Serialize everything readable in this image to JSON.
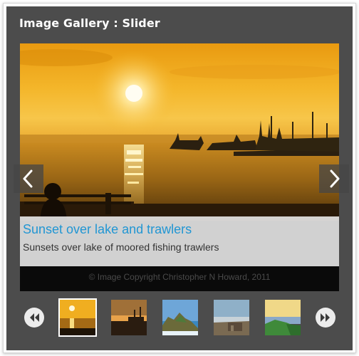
{
  "gallery": {
    "title": "Image Gallery : Slider"
  },
  "slide": {
    "caption_title": "Sunset over lake and trawlers",
    "caption_text": "Sunsets over lake of moored fishing trawlers",
    "copyright": "© Image Copyright Christopher N Howard, 2011"
  },
  "controls": {
    "prev_icon": "chevron-left-icon",
    "next_icon": "chevron-right-icon",
    "rewind_icon": "double-chevron-left-icon",
    "forward_icon": "double-chevron-right-icon"
  },
  "thumbnails": {
    "active_index": 0,
    "items": [
      "sunset-lake",
      "sunset-harbor",
      "coastal-rocks",
      "cliff-ruins",
      "green-coast"
    ]
  },
  "colors": {
    "panel": "#4c4c4c",
    "caption_title": "#2196d3",
    "caption_bg": "#eeeeee"
  }
}
